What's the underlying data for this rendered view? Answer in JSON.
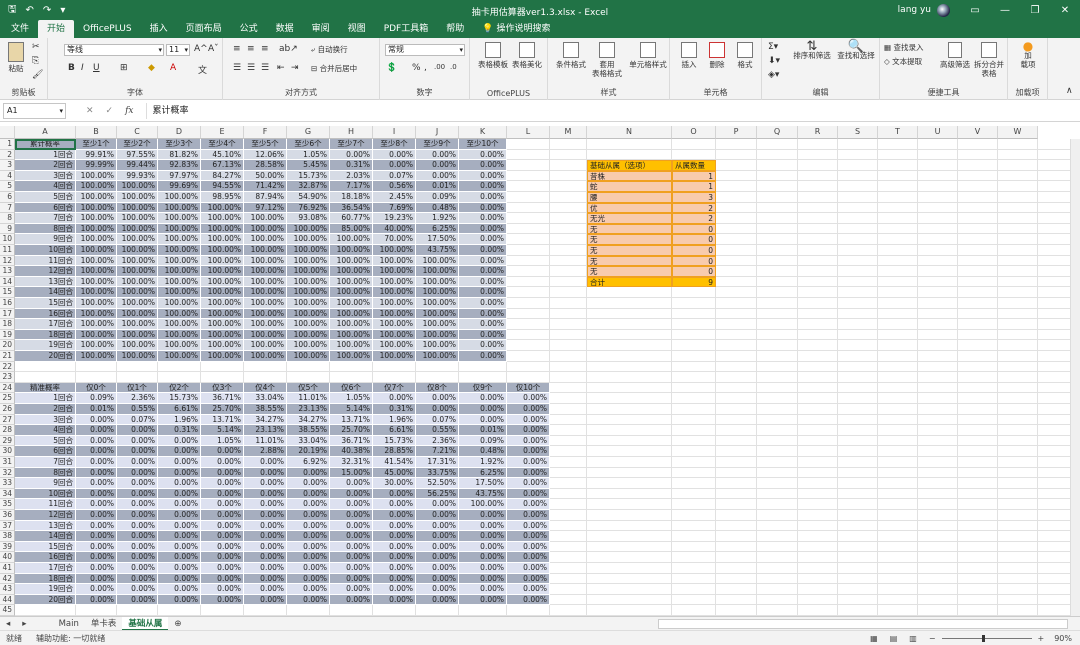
{
  "window": {
    "title": "抽卡用估算器ver1.3.xlsx - Excel",
    "user": "lang yu"
  },
  "tabs": [
    "文件",
    "开始",
    "OfficePLUS",
    "插入",
    "页面布局",
    "公式",
    "数据",
    "审阅",
    "视图",
    "PDF工具箱",
    "帮助"
  ],
  "tell_me": "操作说明搜索",
  "ribbon": {
    "paste": "粘贴",
    "clipboard": "剪贴板",
    "font_name": "等线",
    "font_size": "11",
    "font_group": "字体",
    "wrap": "自动换行",
    "merge": "合并后居中",
    "align_group": "对齐方式",
    "num_format": "常规",
    "num_group": "数字",
    "table_template": "表格模板",
    "table_beautify": "表格美化",
    "officeplus_group": "OfficePLUS",
    "cond_format": "条件格式",
    "table_format": "套用\n表格格式",
    "cell_style": "单元格样式",
    "style_group": "样式",
    "insert": "插入",
    "delete": "删除",
    "format": "格式",
    "cells_group": "单元格",
    "sort": "排序和筛选",
    "find": "查找和选择",
    "edit_group": "编辑",
    "find_entry": "查找录入",
    "text_extract": "文本提取",
    "adv_filter": "高级筛选",
    "split_merge": "拆分合并\n表格",
    "quick_group": "便捷工具",
    "addin": "加\n载项",
    "addin_group": "加载项"
  },
  "formula_bar": {
    "name_box": "A1",
    "content": "累计概率"
  },
  "columns": [
    "A",
    "B",
    "C",
    "D",
    "E",
    "F",
    "G",
    "H",
    "I",
    "J",
    "K",
    "L",
    "M",
    "N",
    "O",
    "P",
    "Q",
    "R",
    "S",
    "T",
    "U",
    "V",
    "W"
  ],
  "table1": {
    "headers": [
      "累计概率",
      "至少1个",
      "至少2个",
      "至少3个",
      "至少4个",
      "至少5个",
      "至少6个",
      "至少7个",
      "至少8个",
      "至少9个",
      "至少10个"
    ],
    "rows": [
      [
        "1回合",
        "99.91%",
        "97.55%",
        "81.82%",
        "45.10%",
        "12.06%",
        "1.05%",
        "0.00%",
        "0.00%",
        "0.00%",
        "0.00%"
      ],
      [
        "2回合",
        "99.99%",
        "99.44%",
        "92.83%",
        "67.13%",
        "28.58%",
        "5.45%",
        "0.31%",
        "0.00%",
        "0.00%",
        "0.00%"
      ],
      [
        "3回合",
        "100.00%",
        "99.93%",
        "97.97%",
        "84.27%",
        "50.00%",
        "15.73%",
        "2.03%",
        "0.07%",
        "0.00%",
        "0.00%"
      ],
      [
        "4回合",
        "100.00%",
        "100.00%",
        "99.69%",
        "94.55%",
        "71.42%",
        "32.87%",
        "7.17%",
        "0.56%",
        "0.01%",
        "0.00%"
      ],
      [
        "5回合",
        "100.00%",
        "100.00%",
        "100.00%",
        "98.95%",
        "87.94%",
        "54.90%",
        "18.18%",
        "2.45%",
        "0.09%",
        "0.00%"
      ],
      [
        "6回合",
        "100.00%",
        "100.00%",
        "100.00%",
        "100.00%",
        "97.12%",
        "76.92%",
        "36.54%",
        "7.69%",
        "0.48%",
        "0.00%"
      ],
      [
        "7回合",
        "100.00%",
        "100.00%",
        "100.00%",
        "100.00%",
        "100.00%",
        "93.08%",
        "60.77%",
        "19.23%",
        "1.92%",
        "0.00%"
      ],
      [
        "8回合",
        "100.00%",
        "100.00%",
        "100.00%",
        "100.00%",
        "100.00%",
        "100.00%",
        "85.00%",
        "40.00%",
        "6.25%",
        "0.00%"
      ],
      [
        "9回合",
        "100.00%",
        "100.00%",
        "100.00%",
        "100.00%",
        "100.00%",
        "100.00%",
        "100.00%",
        "70.00%",
        "17.50%",
        "0.00%"
      ],
      [
        "10回合",
        "100.00%",
        "100.00%",
        "100.00%",
        "100.00%",
        "100.00%",
        "100.00%",
        "100.00%",
        "100.00%",
        "43.75%",
        "0.00%"
      ],
      [
        "11回合",
        "100.00%",
        "100.00%",
        "100.00%",
        "100.00%",
        "100.00%",
        "100.00%",
        "100.00%",
        "100.00%",
        "100.00%",
        "0.00%"
      ],
      [
        "12回合",
        "100.00%",
        "100.00%",
        "100.00%",
        "100.00%",
        "100.00%",
        "100.00%",
        "100.00%",
        "100.00%",
        "100.00%",
        "0.00%"
      ],
      [
        "13回合",
        "100.00%",
        "100.00%",
        "100.00%",
        "100.00%",
        "100.00%",
        "100.00%",
        "100.00%",
        "100.00%",
        "100.00%",
        "0.00%"
      ],
      [
        "14回合",
        "100.00%",
        "100.00%",
        "100.00%",
        "100.00%",
        "100.00%",
        "100.00%",
        "100.00%",
        "100.00%",
        "100.00%",
        "0.00%"
      ],
      [
        "15回合",
        "100.00%",
        "100.00%",
        "100.00%",
        "100.00%",
        "100.00%",
        "100.00%",
        "100.00%",
        "100.00%",
        "100.00%",
        "0.00%"
      ],
      [
        "16回合",
        "100.00%",
        "100.00%",
        "100.00%",
        "100.00%",
        "100.00%",
        "100.00%",
        "100.00%",
        "100.00%",
        "100.00%",
        "0.00%"
      ],
      [
        "17回合",
        "100.00%",
        "100.00%",
        "100.00%",
        "100.00%",
        "100.00%",
        "100.00%",
        "100.00%",
        "100.00%",
        "100.00%",
        "0.00%"
      ],
      [
        "18回合",
        "100.00%",
        "100.00%",
        "100.00%",
        "100.00%",
        "100.00%",
        "100.00%",
        "100.00%",
        "100.00%",
        "100.00%",
        "0.00%"
      ],
      [
        "19回合",
        "100.00%",
        "100.00%",
        "100.00%",
        "100.00%",
        "100.00%",
        "100.00%",
        "100.00%",
        "100.00%",
        "100.00%",
        "0.00%"
      ],
      [
        "20回合",
        "100.00%",
        "100.00%",
        "100.00%",
        "100.00%",
        "100.00%",
        "100.00%",
        "100.00%",
        "100.00%",
        "100.00%",
        "0.00%"
      ]
    ]
  },
  "table2": {
    "headers": [
      "精准概率",
      "仅0个",
      "仅1个",
      "仅2个",
      "仅3个",
      "仅4个",
      "仅5个",
      "仅6个",
      "仅7个",
      "仅8个",
      "仅9个",
      "仅10个"
    ],
    "rows": [
      [
        "1回合",
        "0.09%",
        "2.36%",
        "15.73%",
        "36.71%",
        "33.04%",
        "11.01%",
        "1.05%",
        "0.00%",
        "0.00%",
        "0.00%",
        "0.00%"
      ],
      [
        "2回合",
        "0.01%",
        "0.55%",
        "6.61%",
        "25.70%",
        "38.55%",
        "23.13%",
        "5.14%",
        "0.31%",
        "0.00%",
        "0.00%",
        "0.00%"
      ],
      [
        "3回合",
        "0.00%",
        "0.07%",
        "1.96%",
        "13.71%",
        "34.27%",
        "34.27%",
        "13.71%",
        "1.96%",
        "0.07%",
        "0.00%",
        "0.00%"
      ],
      [
        "4回合",
        "0.00%",
        "0.00%",
        "0.31%",
        "5.14%",
        "23.13%",
        "38.55%",
        "25.70%",
        "6.61%",
        "0.55%",
        "0.01%",
        "0.00%"
      ],
      [
        "5回合",
        "0.00%",
        "0.00%",
        "0.00%",
        "1.05%",
        "11.01%",
        "33.04%",
        "36.71%",
        "15.73%",
        "2.36%",
        "0.09%",
        "0.00%"
      ],
      [
        "6回合",
        "0.00%",
        "0.00%",
        "0.00%",
        "0.00%",
        "2.88%",
        "20.19%",
        "40.38%",
        "28.85%",
        "7.21%",
        "0.48%",
        "0.00%"
      ],
      [
        "7回合",
        "0.00%",
        "0.00%",
        "0.00%",
        "0.00%",
        "0.00%",
        "6.92%",
        "32.31%",
        "41.54%",
        "17.31%",
        "1.92%",
        "0.00%"
      ],
      [
        "8回合",
        "0.00%",
        "0.00%",
        "0.00%",
        "0.00%",
        "0.00%",
        "0.00%",
        "15.00%",
        "45.00%",
        "33.75%",
        "6.25%",
        "0.00%"
      ],
      [
        "9回合",
        "0.00%",
        "0.00%",
        "0.00%",
        "0.00%",
        "0.00%",
        "0.00%",
        "0.00%",
        "30.00%",
        "52.50%",
        "17.50%",
        "0.00%"
      ],
      [
        "10回合",
        "0.00%",
        "0.00%",
        "0.00%",
        "0.00%",
        "0.00%",
        "0.00%",
        "0.00%",
        "0.00%",
        "56.25%",
        "43.75%",
        "0.00%"
      ],
      [
        "11回合",
        "0.00%",
        "0.00%",
        "0.00%",
        "0.00%",
        "0.00%",
        "0.00%",
        "0.00%",
        "0.00%",
        "0.00%",
        "100.00%",
        "0.00%"
      ],
      [
        "12回合",
        "0.00%",
        "0.00%",
        "0.00%",
        "0.00%",
        "0.00%",
        "0.00%",
        "0.00%",
        "0.00%",
        "0.00%",
        "0.00%",
        "0.00%"
      ],
      [
        "13回合",
        "0.00%",
        "0.00%",
        "0.00%",
        "0.00%",
        "0.00%",
        "0.00%",
        "0.00%",
        "0.00%",
        "0.00%",
        "0.00%",
        "0.00%"
      ],
      [
        "14回合",
        "0.00%",
        "0.00%",
        "0.00%",
        "0.00%",
        "0.00%",
        "0.00%",
        "0.00%",
        "0.00%",
        "0.00%",
        "0.00%",
        "0.00%"
      ],
      [
        "15回合",
        "0.00%",
        "0.00%",
        "0.00%",
        "0.00%",
        "0.00%",
        "0.00%",
        "0.00%",
        "0.00%",
        "0.00%",
        "0.00%",
        "0.00%"
      ],
      [
        "16回合",
        "0.00%",
        "0.00%",
        "0.00%",
        "0.00%",
        "0.00%",
        "0.00%",
        "0.00%",
        "0.00%",
        "0.00%",
        "0.00%",
        "0.00%"
      ],
      [
        "17回合",
        "0.00%",
        "0.00%",
        "0.00%",
        "0.00%",
        "0.00%",
        "0.00%",
        "0.00%",
        "0.00%",
        "0.00%",
        "0.00%",
        "0.00%"
      ],
      [
        "18回合",
        "0.00%",
        "0.00%",
        "0.00%",
        "0.00%",
        "0.00%",
        "0.00%",
        "0.00%",
        "0.00%",
        "0.00%",
        "0.00%",
        "0.00%"
      ],
      [
        "19回合",
        "0.00%",
        "0.00%",
        "0.00%",
        "0.00%",
        "0.00%",
        "0.00%",
        "0.00%",
        "0.00%",
        "0.00%",
        "0.00%",
        "0.00%"
      ],
      [
        "20回合",
        "0.00%",
        "0.00%",
        "0.00%",
        "0.00%",
        "0.00%",
        "0.00%",
        "0.00%",
        "0.00%",
        "0.00%",
        "0.00%",
        "0.00%"
      ]
    ]
  },
  "side_table": {
    "headers": [
      "基础从属（选项）",
      "从属数量"
    ],
    "rows": [
      [
        "昔株",
        "1"
      ],
      [
        "蛇",
        "1"
      ],
      [
        "腰",
        "3"
      ],
      [
        "优",
        "2"
      ],
      [
        "无光",
        "2"
      ],
      [
        "无",
        "0"
      ],
      [
        "无",
        "0"
      ],
      [
        "无",
        "0"
      ],
      [
        "无",
        "0"
      ],
      [
        "无",
        "0"
      ]
    ],
    "total": [
      "合计",
      "9"
    ]
  },
  "sheets": [
    "Main",
    "单卡表",
    "基础从属"
  ],
  "active_sheet": "基础从属",
  "status": {
    "ready": "就绪",
    "accessibility": "辅助功能: 一切就绪",
    "zoom": "90%"
  },
  "colors": {
    "excel_green": "#217346",
    "table_dark": "#a6aebf",
    "table_light": "#d6dbe5",
    "side_header": "#ffc000",
    "side_body": "#f8cbad"
  }
}
